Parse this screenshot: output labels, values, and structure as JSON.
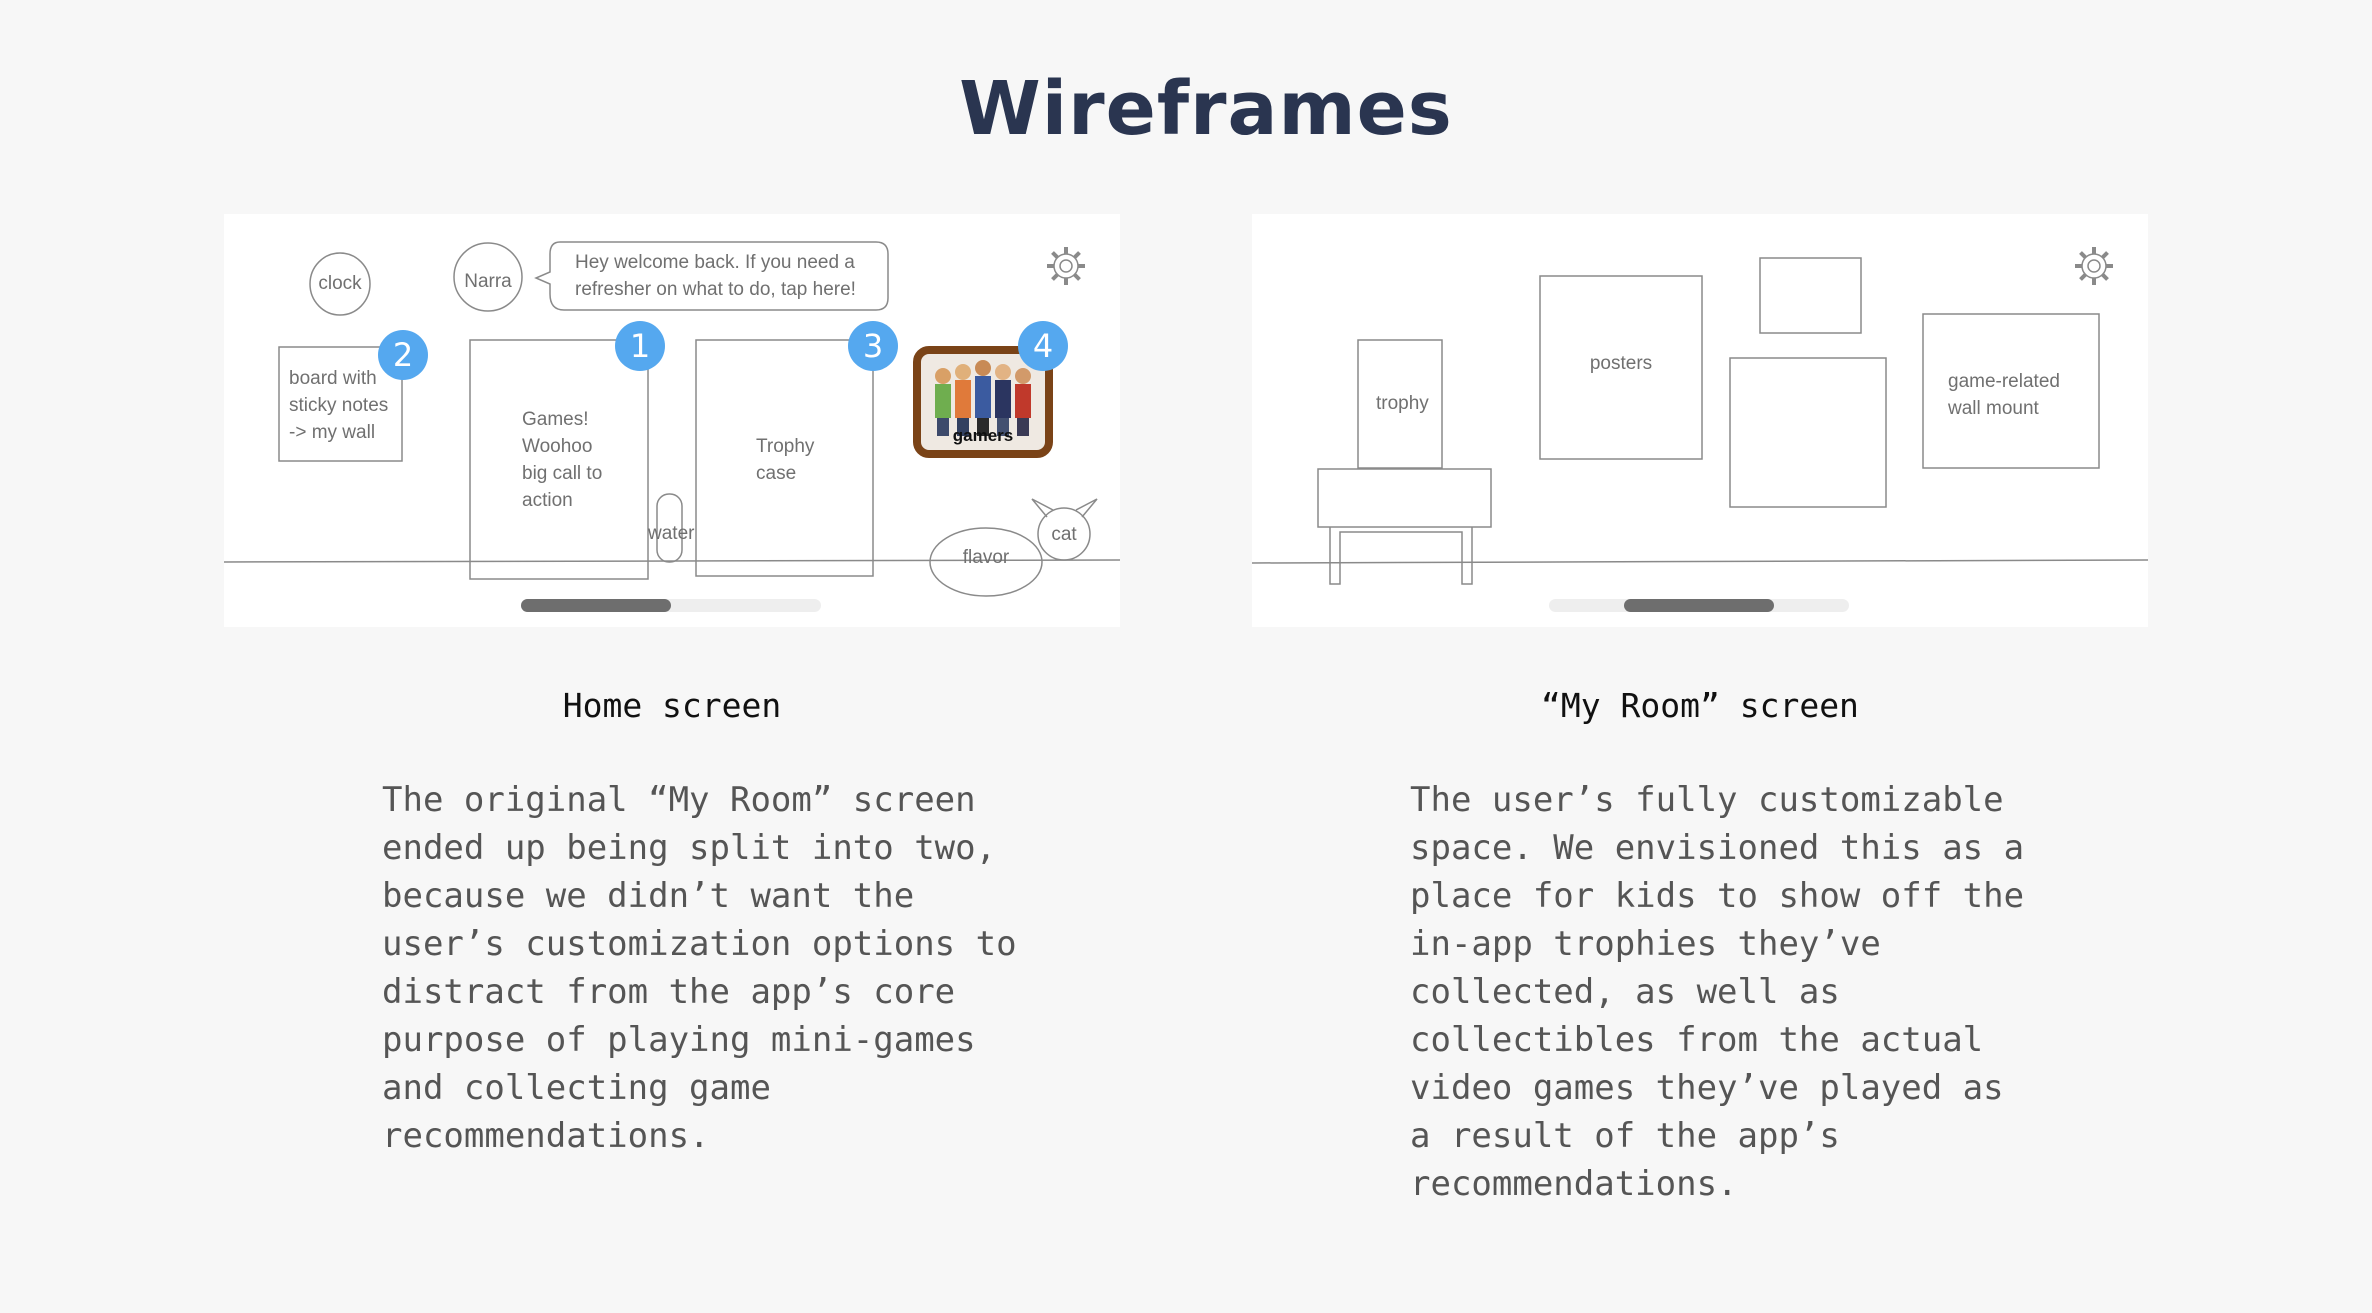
{
  "title": "Wireframes",
  "home": {
    "clock": "clock",
    "narrator": "Narra",
    "speech": "Hey welcome back. If you need a\nrefresher on what to do, tap here!",
    "board": "board with\nsticky notes\n-> my wall",
    "games": "Games!\nWoohoo\nbig call to\naction",
    "water": "water",
    "trophy_case": "Trophy\ncase",
    "photo_caption": "gamers",
    "flavor": "flavor",
    "cat": "cat",
    "badges": [
      "1",
      "2",
      "3",
      "4"
    ],
    "scroll_position": 0.0,
    "settings_icon": "gear-icon"
  },
  "room": {
    "trophy": "trophy",
    "posters": "posters",
    "wall_mount": "game-related\nwall mount",
    "scroll_position": 0.5,
    "settings_icon": "gear-icon"
  },
  "captions": {
    "home": "Home screen",
    "room": "“My Room” screen"
  },
  "descriptions": {
    "home": "The original “My Room” screen\nended up being split into two,\nbecause we didn’t want the\nuser’s customization options to\ndistract from the app’s core\npurpose of playing mini-games\nand collecting game\nrecommendations.",
    "room": "The user’s fully customizable\nspace. We envisioned this as a\nplace for kids to show off the\nin-app trophies they’ve\ncollected, as well as\ncollectibles from the actual\nvideo games they’ve played as\na result of the app’s\nrecommendations."
  },
  "colors": {
    "badge": "#55a8ef",
    "frame": "#7a4317",
    "title": "#2a3550"
  }
}
